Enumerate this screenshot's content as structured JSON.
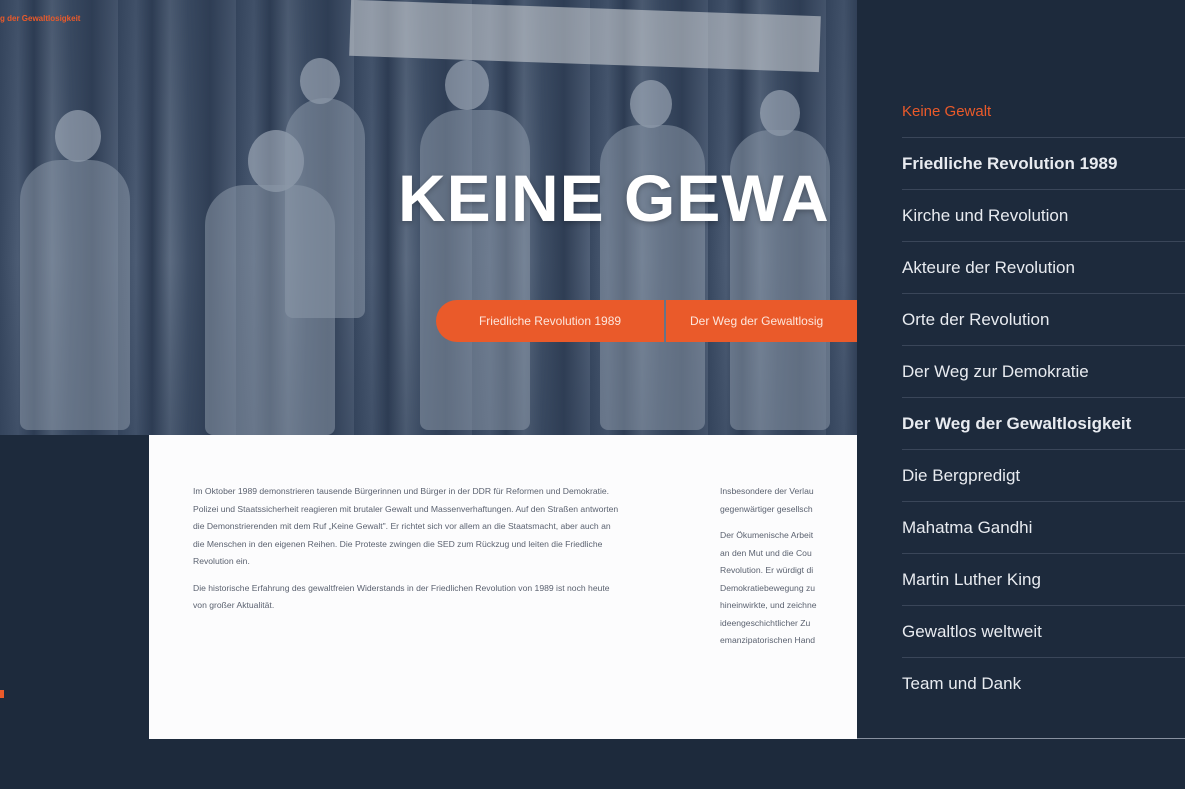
{
  "breadcrumb": "g der Gewaltlosigkeit",
  "hero": {
    "title": "KEINE GEWA",
    "buttons": [
      "Friedliche Revolution 1989",
      "Der Weg der Gewaltlosig"
    ]
  },
  "content": {
    "column1": [
      "Im Oktober 1989 demonstrieren tausende Bürgerinnen und Bürger in der DDR für Reformen und Demokratie. Polizei und Staatssicherheit reagieren mit brutaler Gewalt und Massenverhaftungen. Auf den Straßen antworten die Demonstrierenden mit dem Ruf „Keine Gewalt\". Er richtet sich vor allem an die Staatsmacht, aber auch an die Menschen in den eigenen Reihen. Die Proteste zwingen die SED zum Rückzug und leiten die Friedliche Revolution ein.",
      "Die historische Erfahrung des gewaltfreien Widerstands in der Friedlichen Revolution von 1989 ist noch heute von großer Aktualität."
    ],
    "column2_lines": [
      "Insbesondere der Verlau",
      "gegenwärtiger gesellsch",
      "Der Ökumenische Arbeit",
      "an den Mut und die Cou",
      "Revolution. Er würdigt di",
      "Demokratiebewegung zu",
      "hineinwirkte, und zeichne",
      "ideengeschichtlicher Zu",
      "emanzipatorischen Hand"
    ]
  },
  "menu": {
    "items": [
      {
        "label": "Keine Gewalt"
      },
      {
        "label": "Friedliche Revolution 1989"
      },
      {
        "label": "Kirche und Revolution"
      },
      {
        "label": "Akteure der Revolution"
      },
      {
        "label": "Orte der Revolution"
      },
      {
        "label": "Der Weg zur Demokratie"
      },
      {
        "label": "Der Weg der Gewaltlosigkeit"
      },
      {
        "label": "Die Bergpredigt"
      },
      {
        "label": "Mahatma Gandhi"
      },
      {
        "label": "Martin Luther King"
      },
      {
        "label": "Gewaltlos weltweit"
      },
      {
        "label": "Team und Dank"
      }
    ]
  },
  "colors": {
    "accent": "#ea5a2a",
    "navy": "#1d2a3c",
    "card": "#fcfcfd"
  }
}
